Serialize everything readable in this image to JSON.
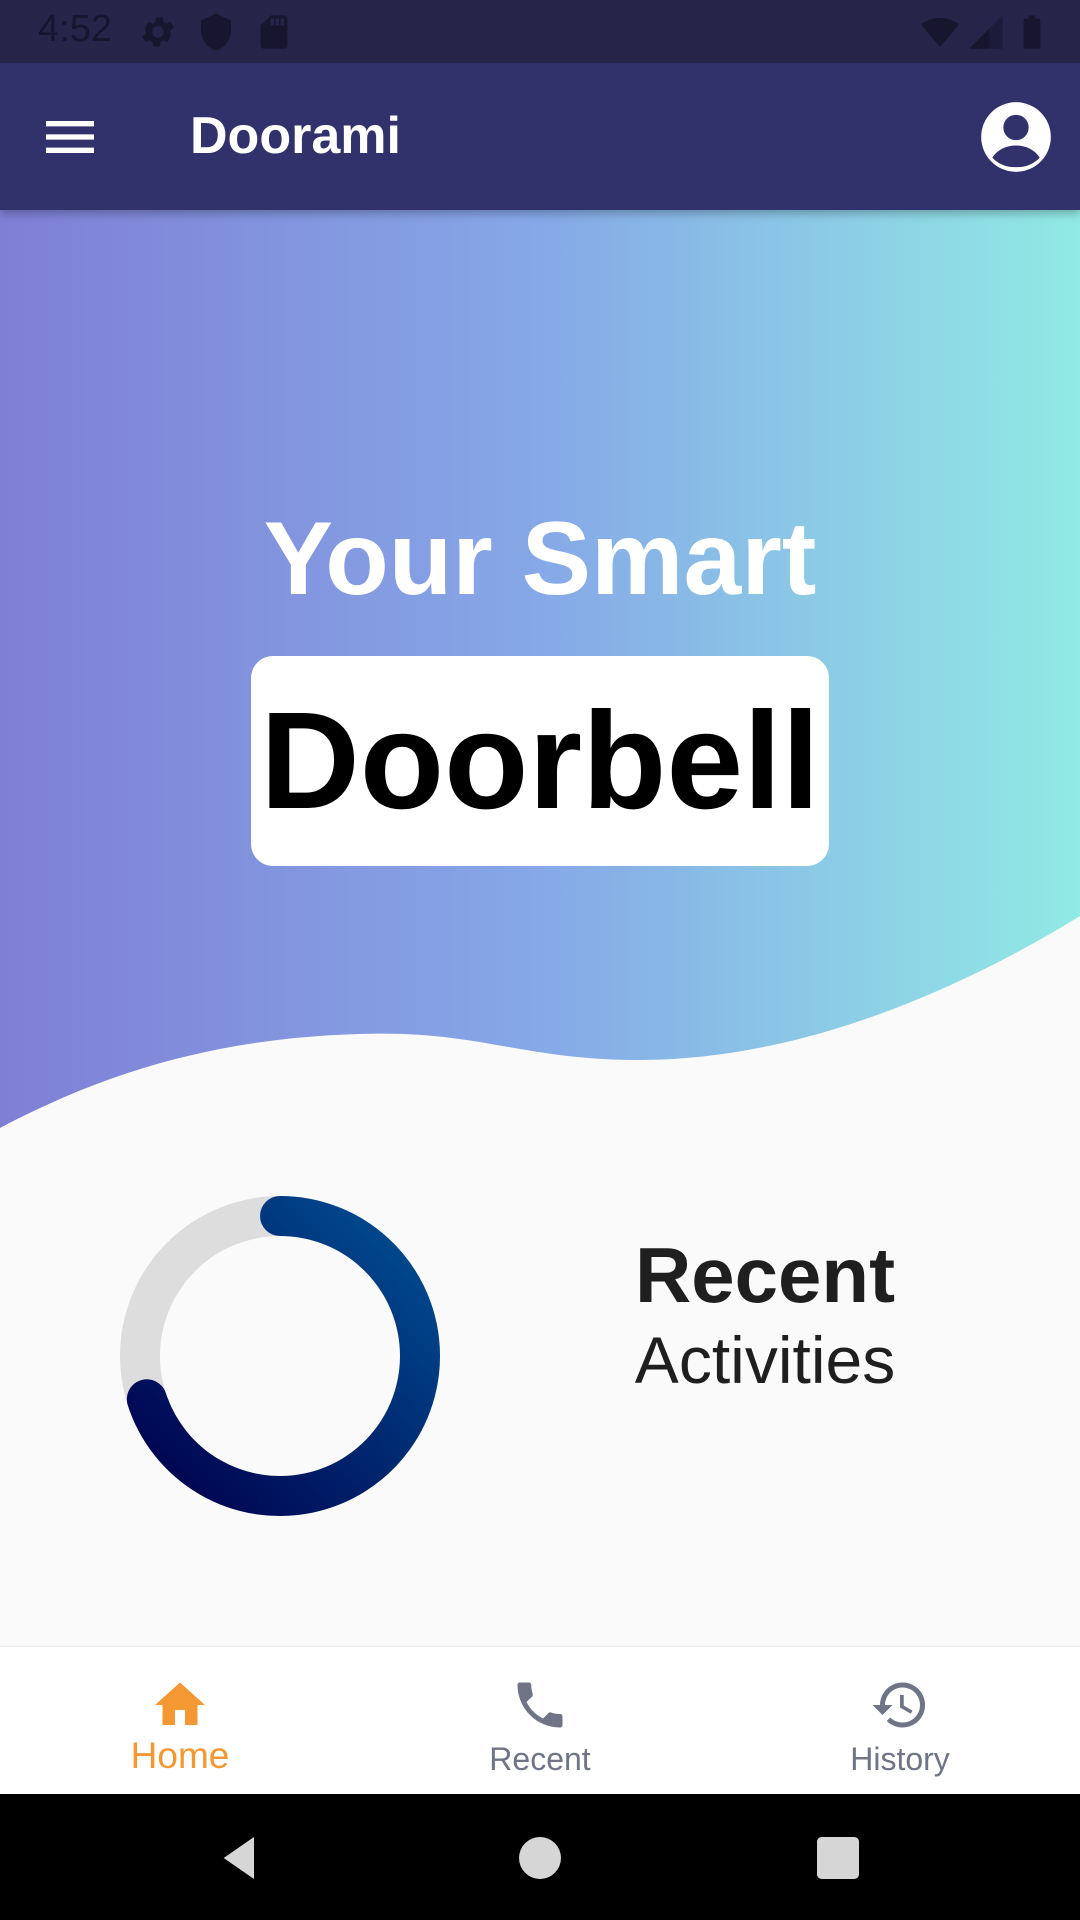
{
  "status_bar": {
    "time": "4:52",
    "left_icons": [
      "gear-icon",
      "shield-icon",
      "sd-card-icon"
    ],
    "right_icons": [
      "wifi-icon",
      "signal-icon",
      "battery-icon"
    ]
  },
  "app_bar": {
    "title": "Doorami",
    "menu_icon": "menu-icon",
    "account_icon": "account-circle-icon"
  },
  "hero": {
    "line1": "Your Smart",
    "line2": "Doorbell",
    "gradient_start": "#7f7fd5",
    "gradient_mid": "#86a8e7",
    "gradient_end": "#91eae4"
  },
  "activity": {
    "title": "Recent",
    "subtitle": "Activities",
    "progress_fraction": 0.7,
    "ring_track_color": "#dddddd",
    "ring_color_start": "#00004d",
    "ring_color_end": "#004e92"
  },
  "bottom_nav": {
    "items": [
      {
        "label": "Home",
        "icon": "home-icon",
        "active": true
      },
      {
        "label": "Recent",
        "icon": "phone-icon",
        "active": false
      },
      {
        "label": "History",
        "icon": "history-icon",
        "active": false
      }
    ],
    "active_color": "#f39833",
    "inactive_color": "#6f7586"
  },
  "system_nav": {
    "buttons": [
      "back-icon",
      "home-circle-icon",
      "recents-square-icon"
    ]
  }
}
